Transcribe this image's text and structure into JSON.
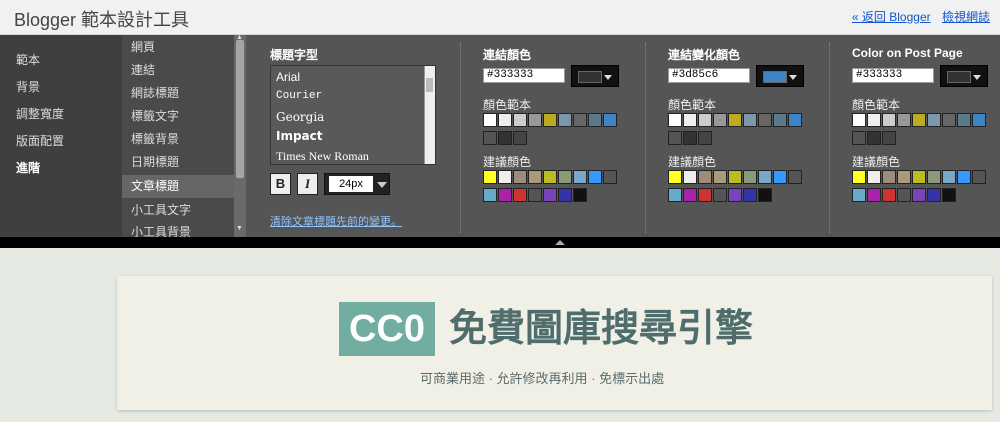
{
  "header": {
    "app_title": "Blogger 範本設計工具",
    "back_link": "« 返回 Blogger",
    "view_blog_link": "檢視網誌"
  },
  "categories": [
    "範本",
    "背景",
    "調整寬度",
    "版面配置",
    "進階"
  ],
  "active_category": "進階",
  "subitems": [
    "網頁",
    "連結",
    "網誌標題",
    "標籤文字",
    "標籤背景",
    "日期標題",
    "文章標題",
    "小工具文字",
    "小工具背景"
  ],
  "active_subitem": "文章標題",
  "font_section": {
    "title": "標題字型",
    "fonts": [
      "Arial",
      "Courier",
      "Georgia",
      "Impact",
      "Times New Roman"
    ],
    "bold_label": "B",
    "italic_label": "I",
    "size": "24px",
    "clear_link": "清除文章標題先前的變更。"
  },
  "color_sections": [
    {
      "title": "連結顏色",
      "hex": "#333333",
      "current_color": "#333333",
      "palette_label": "顏色範本",
      "suggested_label": "建議顏色"
    },
    {
      "title": "連結變化顏色",
      "hex": "#3d85c6",
      "current_color": "#3d85c6",
      "palette_label": "顏色範本",
      "suggested_label": "建議顏色"
    },
    {
      "title": "Color on Post Page",
      "hex": "#333333",
      "current_color": "#333333",
      "palette_label": "顏色範本",
      "suggested_label": "建議顏色"
    }
  ],
  "template_colors": [
    "#ffffff",
    "#eeeeee",
    "#cccccc",
    "#999999",
    "#bbaa22",
    "#7b97aa",
    "#666666",
    "#5a7a8a",
    "#3d85c6",
    "#555555",
    "#333333",
    "#444444"
  ],
  "suggested_colors": [
    "#ffff22",
    "#eeeeee",
    "#a08a7a",
    "#a89a7a",
    "#bbbb22",
    "#8a9a7a",
    "#7aa8c8",
    "#3399ff",
    "#555555",
    "#66aacc",
    "#aa22aa",
    "#cc3333",
    "#555555",
    "#7744bb",
    "#3333aa",
    "#111111"
  ],
  "preview": {
    "badge": "CC0",
    "title": "免費圖庫搜尋引擎",
    "subtitle": "可商業用途 · 允許修改再利用 · 免標示出處"
  }
}
